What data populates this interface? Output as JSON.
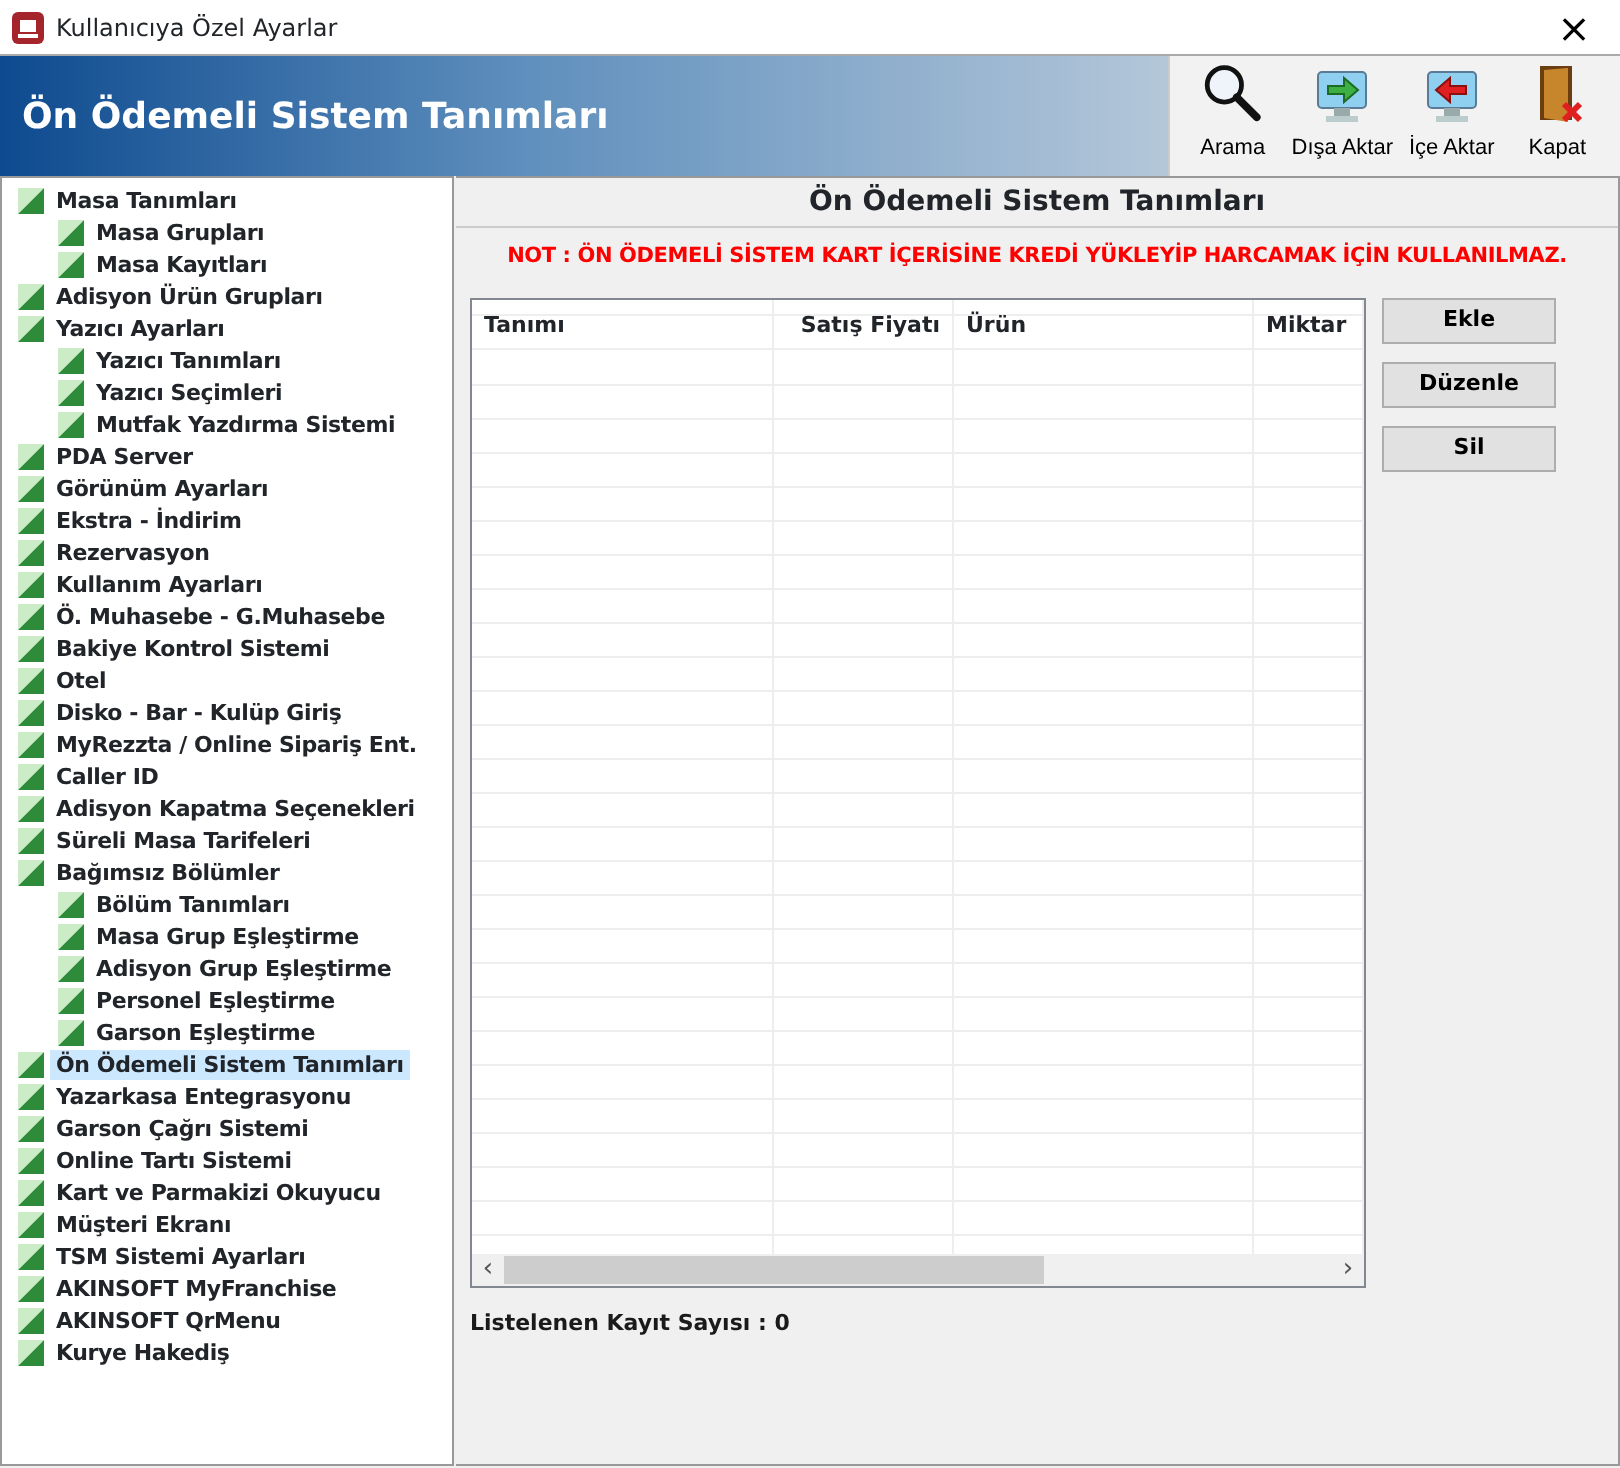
{
  "window": {
    "title": "Kullanıcıya Özel Ayarlar",
    "close": "×"
  },
  "header": {
    "title": "Ön Ödemeli Sistem Tanımları"
  },
  "toolbar": [
    {
      "label": "Arama",
      "kind": "search"
    },
    {
      "label": "Dışa Aktar",
      "kind": "export"
    },
    {
      "label": "İçe Aktar",
      "kind": "import"
    },
    {
      "label": "Kapat",
      "kind": "close"
    }
  ],
  "sidebar": {
    "items": [
      {
        "label": "Masa Tanımları",
        "selected": false,
        "children": [
          {
            "label": "Masa Grupları",
            "selected": false
          },
          {
            "label": "Masa Kayıtları",
            "selected": false
          }
        ]
      },
      {
        "label": "Adisyon Ürün Grupları",
        "selected": false
      },
      {
        "label": "Yazıcı Ayarları",
        "selected": false,
        "children": [
          {
            "label": "Yazıcı Tanımları",
            "selected": false
          },
          {
            "label": "Yazıcı Seçimleri",
            "selected": false
          },
          {
            "label": "Mutfak Yazdırma Sistemi",
            "selected": false
          }
        ]
      },
      {
        "label": "PDA Server",
        "selected": false
      },
      {
        "label": "Görünüm Ayarları",
        "selected": false
      },
      {
        "label": "Ekstra - İndirim",
        "selected": false
      },
      {
        "label": "Rezervasyon",
        "selected": false
      },
      {
        "label": "Kullanım Ayarları",
        "selected": false
      },
      {
        "label": "Ö. Muhasebe - G.Muhasebe",
        "selected": false
      },
      {
        "label": "Bakiye Kontrol Sistemi",
        "selected": false
      },
      {
        "label": "Otel",
        "selected": false
      },
      {
        "label": "Disko - Bar - Kulüp Giriş",
        "selected": false
      },
      {
        "label": "MyRezzta / Online Sipariş Ent.",
        "selected": false
      },
      {
        "label": "Caller ID",
        "selected": false
      },
      {
        "label": "Adisyon Kapatma Seçenekleri",
        "selected": false
      },
      {
        "label": "Süreli Masa Tarifeleri",
        "selected": false
      },
      {
        "label": "Bağımsız Bölümler",
        "selected": false,
        "children": [
          {
            "label": "Bölüm Tanımları",
            "selected": false
          },
          {
            "label": "Masa Grup Eşleştirme",
            "selected": false
          },
          {
            "label": "Adisyon Grup Eşleştirme",
            "selected": false
          },
          {
            "label": "Personel Eşleştirme",
            "selected": false
          },
          {
            "label": "Garson Eşleştirme",
            "selected": false
          }
        ]
      },
      {
        "label": "Ön Ödemeli Sistem Tanımları",
        "selected": true
      },
      {
        "label": "Yazarkasa Entegrasyonu",
        "selected": false
      },
      {
        "label": "Garson Çağrı Sistemi",
        "selected": false
      },
      {
        "label": "Online Tartı Sistemi",
        "selected": false
      },
      {
        "label": "Kart ve Parmakizi Okuyucu",
        "selected": false
      },
      {
        "label": "Müşteri Ekranı",
        "selected": false
      },
      {
        "label": "TSM Sistemi Ayarları",
        "selected": false
      },
      {
        "label": "AKINSOFT MyFranchise",
        "selected": false
      },
      {
        "label": "AKINSOFT QrMenu",
        "selected": false
      },
      {
        "label": "Kurye Hakediş",
        "selected": false
      }
    ]
  },
  "panel": {
    "title": "Ön Ödemeli Sistem Tanımları",
    "note": "NOT : ÖN ÖDEMELİ SİSTEM KART İÇERİSİNE KREDİ YÜKLEYİP HARCAMAK İÇİN KULLANILMAZ.",
    "table": {
      "columns": [
        "Tanımı",
        "Satış Fiyatı",
        "Ürün",
        "Miktar"
      ],
      "scroll_left": "‹",
      "scroll_right": "›"
    },
    "buttons": [
      "Ekle",
      "Düzenle",
      "Sil"
    ],
    "record_count": "Listelenen Kayıt Sayısı : 0"
  }
}
